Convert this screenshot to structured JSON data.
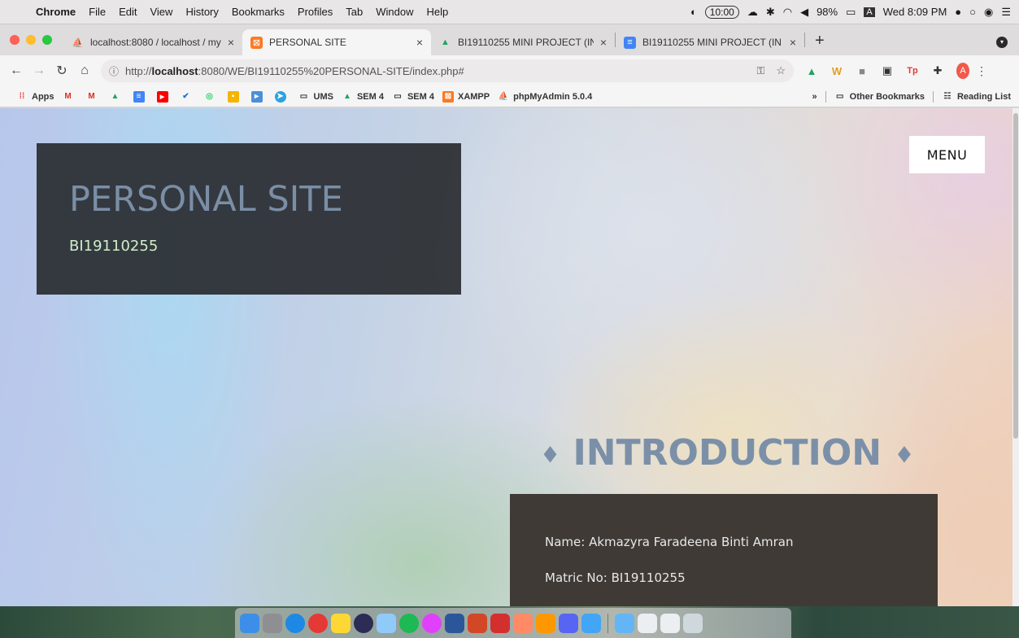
{
  "menubar": {
    "app_name": "Chrome",
    "items": [
      "File",
      "Edit",
      "View",
      "History",
      "Bookmarks",
      "Profiles",
      "Tab",
      "Window",
      "Help"
    ],
    "timer_badge": "10:00",
    "battery": "98%",
    "input_indicator": "A",
    "clock": "Wed 8:09 PM"
  },
  "tabs": [
    {
      "title": "localhost:8080 / localhost / my",
      "close": "×",
      "icon": "phpmyadmin-icon"
    },
    {
      "title": "PERSONAL SITE",
      "close": "×",
      "icon": "xampp-icon",
      "active": true
    },
    {
      "title": "BI19110255 MINI PROJECT (IN",
      "close": "×",
      "icon": "drive-icon"
    },
    {
      "title": "BI19110255 MINI PROJECT (IN",
      "close": "×",
      "icon": "docs-icon"
    }
  ],
  "toolbar": {
    "url_prefix": "http://",
    "url_host": "localhost",
    "url_rest": ":8080/WE/BI19110255%20PERSONAL-SITE/index.php#",
    "profile_initial": "A"
  },
  "bookmarks": {
    "apps": "Apps",
    "items": [
      {
        "label": "UMS",
        "icon": "folder-icon"
      },
      {
        "label": "SEM 4",
        "icon": "drive-icon"
      },
      {
        "label": "SEM 4",
        "icon": "folder-icon"
      },
      {
        "label": "XAMPP",
        "icon": "xampp-icon"
      },
      {
        "label": "phpMyAdmin 5.0.4",
        "icon": "phpmyadmin-icon"
      }
    ],
    "overflow": "»",
    "other": "Other Bookmarks",
    "reading_list": "Reading List"
  },
  "page": {
    "hero_title": "PERSONAL SITE",
    "hero_subtitle": "BI19110255",
    "menu_button": "MENU",
    "intro_heading": "INTRODUCTION",
    "intro_diamond": "♦",
    "intro_lines": [
      "Name: Akmazyra Faradeena Binti Amran",
      "Matric No: BI19110255"
    ]
  },
  "colors": {
    "hero_bg": "#2a2d32",
    "hero_title": "#7a8ea6",
    "hero_subtitle": "#cfeecb",
    "intro_heading": "#7b90a8",
    "intro_box": "#3f3a36"
  },
  "dock_icons": [
    "finder-icon",
    "launchpad-icon",
    "safari-icon",
    "chrome-icon",
    "notes-icon",
    "eclipse-icon",
    "preview-icon",
    "spotify-icon",
    "music-icon",
    "word-icon",
    "powerpoint-icon",
    "acrobat-icon",
    "archive-icon",
    "sublime-icon",
    "discord-icon",
    "appstore-icon",
    "downloads-folder-icon",
    "document-icon",
    "document-icon",
    "trash-icon"
  ]
}
